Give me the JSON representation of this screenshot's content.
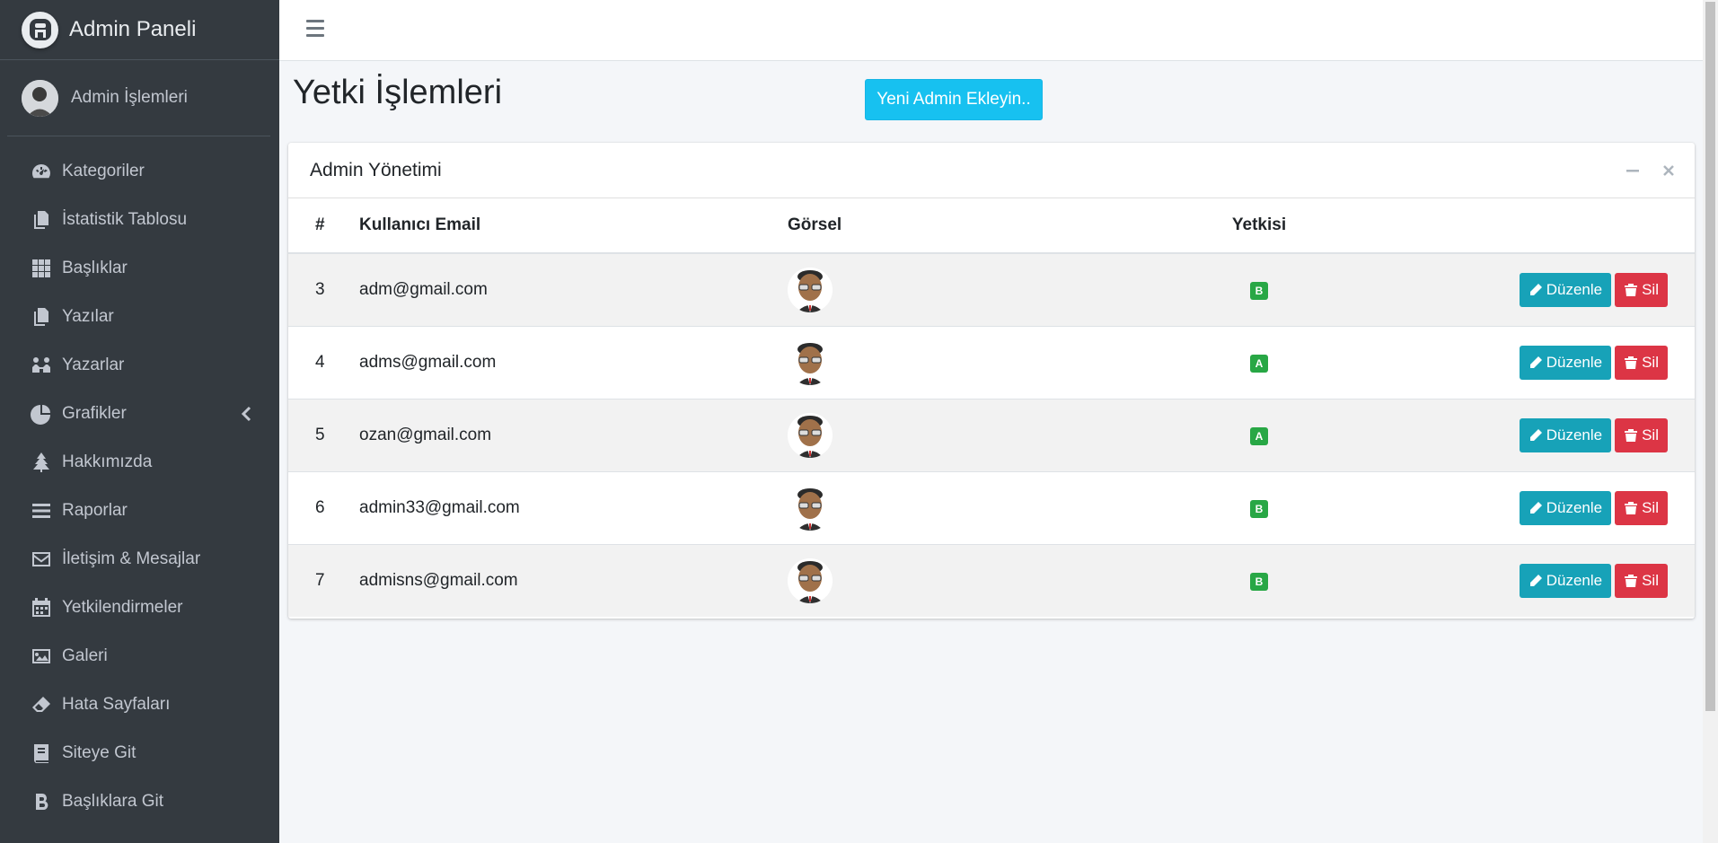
{
  "brand": {
    "title": "Admin Paneli"
  },
  "user": {
    "name": "Admin İşlemleri"
  },
  "sidebar": {
    "items": [
      {
        "label": "Kategoriler",
        "icon": "tachometer-icon"
      },
      {
        "label": "İstatistik Tablosu",
        "icon": "copy-icon"
      },
      {
        "label": "Başlıklar",
        "icon": "grid-icon"
      },
      {
        "label": "Yazılar",
        "icon": "copy-icon"
      },
      {
        "label": "Yazarlar",
        "icon": "users-icon"
      },
      {
        "label": "Grafikler",
        "icon": "pie-chart-icon"
      },
      {
        "label": "Hakkımızda",
        "icon": "tree-icon"
      },
      {
        "label": "Raporlar",
        "icon": "list-icon"
      },
      {
        "label": "İletişim & Mesajlar",
        "icon": "envelope-icon"
      },
      {
        "label": "Yetkilendirmeler",
        "icon": "calendar-icon"
      },
      {
        "label": "Galeri",
        "icon": "image-icon"
      },
      {
        "label": "Hata Sayfaları",
        "icon": "eraser-icon"
      },
      {
        "label": "Siteye Git",
        "icon": "book-icon"
      },
      {
        "label": "Başlıklara Git",
        "icon": "bold-icon"
      }
    ]
  },
  "page": {
    "title": "Yetki İşlemleri",
    "add_button": "Yeni Admin Ekleyin.."
  },
  "card": {
    "title": "Admin Yönetimi",
    "columns": [
      "#",
      "Kullanıcı Email",
      "Görsel",
      "Yetkisi"
    ],
    "rows": [
      {
        "id": "3",
        "email": "adm@gmail.com",
        "role": "B"
      },
      {
        "id": "4",
        "email": "adms@gmail.com",
        "role": "A"
      },
      {
        "id": "5",
        "email": "ozan@gmail.com",
        "role": "A"
      },
      {
        "id": "6",
        "email": "admin33@gmail.com",
        "role": "B"
      },
      {
        "id": "7",
        "email": "admisns@gmail.com",
        "role": "B"
      }
    ],
    "edit_label": "Düzenle",
    "delete_label": "Sil"
  },
  "colors": {
    "sidebar_bg": "#343a40",
    "primary_button": "#17c1f0",
    "edit_button": "#17a2b8",
    "delete_button": "#dc3545",
    "badge": "#28a745"
  }
}
